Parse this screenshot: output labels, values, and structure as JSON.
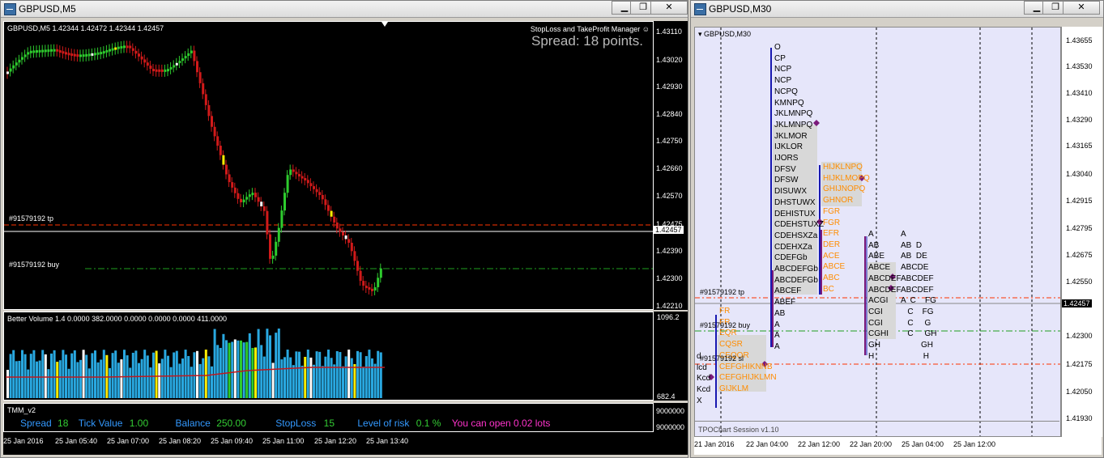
{
  "left_window": {
    "title": "GBPUSD,M5",
    "chart_header": "GBPUSD,M5  1.42344 1.42472 1.42344 1.42457",
    "spread_text": "Spread: 18 points.",
    "manager_title": "StopLoss and TakeProfit Manager",
    "price_axis": [
      "1.43110",
      "1.43020",
      "1.42930",
      "1.42840",
      "1.42750",
      "1.42660",
      "1.42570",
      "1.42475",
      "1.42390",
      "1.42300",
      "1.42210"
    ],
    "current_price": "1.42457",
    "tp_label": "#91579192 tp",
    "buy_label": "#91579192 buy",
    "volume_header": "Better Volume 1.4 0.0000 382.0000 0.0000 0.0000 0.0000 411.0000",
    "volume_axis": [
      "1096.2",
      "682.4",
      "0.00"
    ],
    "tmm_title": "TMM_v2",
    "tmm_axis": [
      "9000000",
      "9000000"
    ],
    "tmm_fields": [
      {
        "label": "Spread",
        "value": "18"
      },
      {
        "label": "Tick Value",
        "value": "1.00"
      },
      {
        "label": "Balance",
        "value": "250.00"
      },
      {
        "label": "StopLoss",
        "value": "15"
      },
      {
        "label": "Level of risk",
        "value": "0.1 %"
      }
    ],
    "tmm_open": "You can open 0.02 lots",
    "time_axis": [
      "25 Jan 2016",
      "25 Jan 05:40",
      "25 Jan 07:00",
      "25 Jan 08:20",
      "25 Jan 09:40",
      "25 Jan 11:00",
      "25 Jan 12:20",
      "25 Jan 13:40"
    ]
  },
  "right_window": {
    "title": "GBPUSD,M30",
    "chart_header": "GBPUSD,M30",
    "price_axis": [
      "1.43655",
      "1.43530",
      "1.43410",
      "1.43290",
      "1.43165",
      "1.43040",
      "1.42915",
      "1.42795",
      "1.42675",
      "1.42550",
      "1.42300",
      "1.42175",
      "1.42050",
      "1.41930"
    ],
    "current_price": "1.42457",
    "tp_label": "#91579192 tp",
    "buy_label": "#91579192 buy",
    "sl_label": "#91579192 sl",
    "indicator_label": "TPOChart Session v1.10",
    "time_axis": [
      "21 Jan 2016",
      "22 Jan 04:00",
      "22 Jan 12:00",
      "22 Jan 20:00",
      "25 Jan 04:00",
      "25 Jan 12:00"
    ],
    "profile_1": [
      "O",
      "CP",
      "NCP",
      "NCP",
      "NCPQ",
      "KMNPQ",
      "JKLMNPQ",
      "JKLMNPQ",
      "JKLMOR",
      "IJKLOR",
      "IJORS",
      "DFSV",
      "DFSW",
      "DISUWX",
      "DHSTUWX",
      "DEHISTUX",
      "CDEHSTUXZ",
      "CDEHSXZa",
      "CDEHXZa",
      "CDEFGb",
      "ABCDEFGb",
      "ABCDEFGb",
      "ABCEF",
      "ABEF",
      "AB",
      "A",
      "A",
      "A"
    ],
    "profile_2": [
      "HIJKLNPQ",
      "HIJKLMOPQ",
      "GHIJNOPQ",
      "GHNOR",
      "FGR",
      "FGR",
      "EFR",
      "DER",
      "ACE",
      "ABCE",
      "ABC",
      "BC"
    ],
    "profile_3": [
      "A",
      "AB",
      "ABE",
      "ABCE",
      "ABCDEF",
      "ABCDEF",
      "ACGI",
      "CGI",
      "CGI",
      "CGHI",
      "GH",
      "H"
    ],
    "profile_4": [
      "A",
      "AB  D",
      "AB  DE",
      "ABCDE",
      "ABCDEF",
      "ABCDEF",
      "A  C    FG",
      "   C    FG",
      "   C     G",
      "   C     GH",
      "         GH",
      "          H"
    ],
    "profile_4b": [
      "",
      "",
      "",
      "",
      "",
      "",
      "",
      "I",
      "I",
      "I",
      "",
      ""
    ],
    "profile_left_orange": [
      "FR",
      "FR",
      "EQR",
      "CQSR",
      "CEQOR",
      "CEFGHIKNNB",
      "CEFGHIJKLMN",
      "GIJKLM"
    ],
    "profile_left_black": [
      "d",
      "lcd",
      "Kcd",
      "Kcd",
      "X"
    ]
  },
  "colors": {
    "bull": "#2ecc2e",
    "bear": "#d11a1a",
    "tp_line": "#ff3300",
    "buy_line": "#1f9f1f",
    "profile_purple": "#7b1a7b",
    "profile_blue": "#1818b0",
    "profile_orange": "#ff8c00",
    "tmm_label": "#3399ff",
    "tmm_value": "#33cc33",
    "tmm_open": "#ff33cc"
  },
  "icons": [
    "window-icon",
    "minimize-icon",
    "maximize-icon",
    "close-icon",
    "smiley-icon",
    "diamond-marker-icon"
  ]
}
